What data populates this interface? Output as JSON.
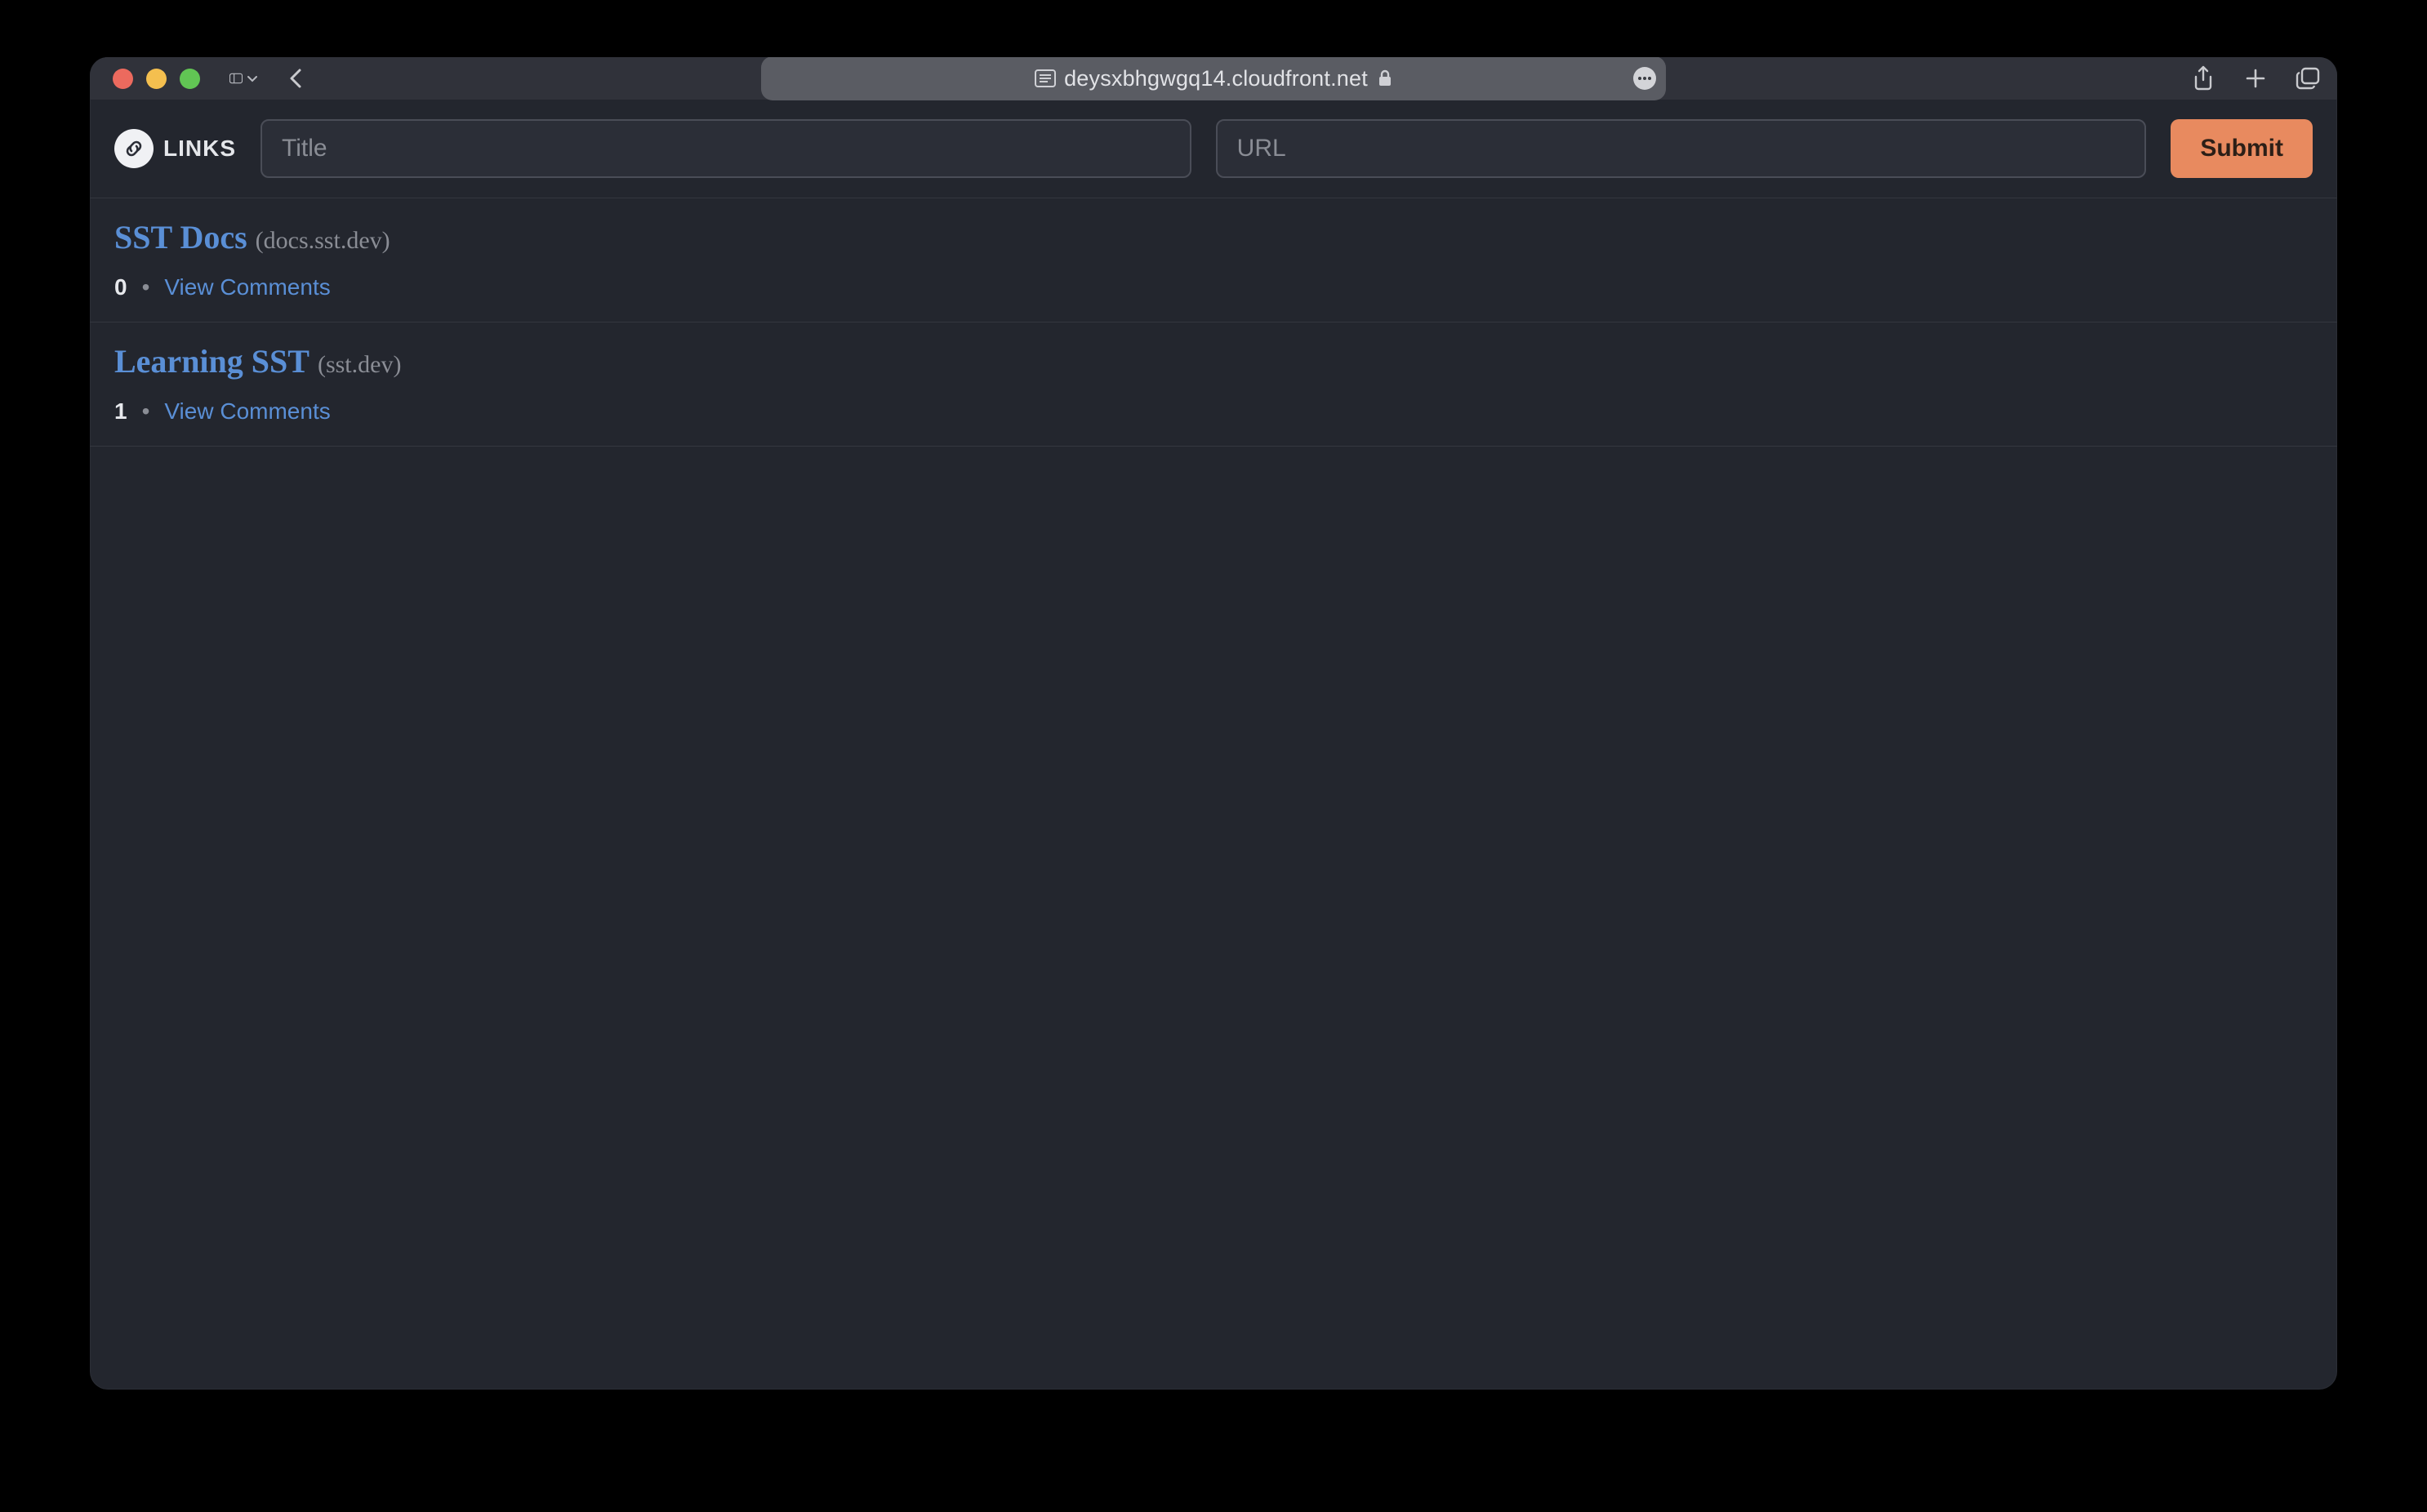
{
  "browser": {
    "address": "deysxbhgwgq14.cloudfront.net"
  },
  "header": {
    "brand": "LINKS",
    "title_placeholder": "Title",
    "url_placeholder": "URL",
    "submit_label": "Submit"
  },
  "posts": [
    {
      "title": "SST Docs",
      "domain": "(docs.sst.dev)",
      "comment_count": "0",
      "comments_label": "View Comments"
    },
    {
      "title": "Learning SST",
      "domain": "(sst.dev)",
      "comment_count": "1",
      "comments_label": "View Comments"
    }
  ],
  "colors": {
    "accent": "#e88a5f",
    "link": "#5a8fd6",
    "bg": "#23262e"
  }
}
